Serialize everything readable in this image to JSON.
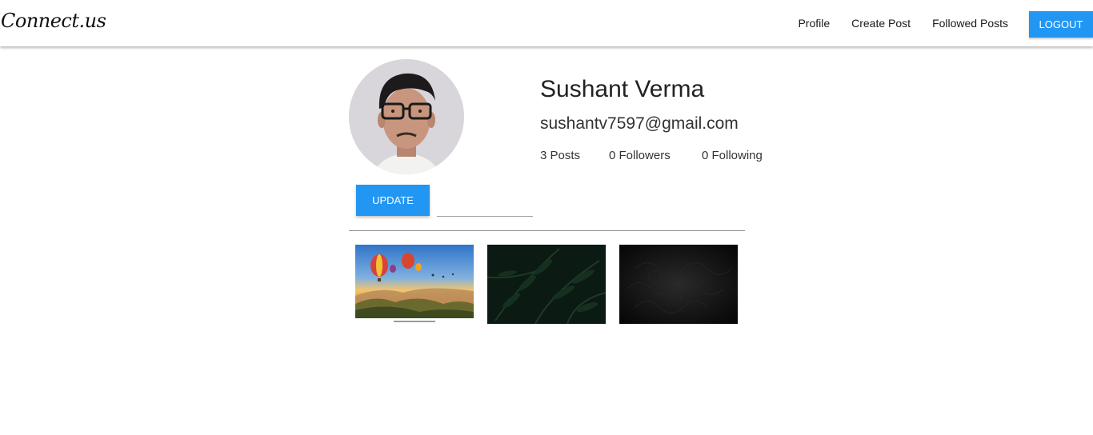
{
  "app": {
    "brand": "Connect.us"
  },
  "nav": {
    "links": [
      {
        "label": "Profile"
      },
      {
        "label": "Create Post"
      },
      {
        "label": "Followed Posts"
      }
    ],
    "logout_label": "LOGOUT"
  },
  "profile": {
    "name": "Sushant Verma",
    "email": "sushantv7597@gmail.com",
    "stats": {
      "posts": "3 Posts",
      "followers": "0 Followers",
      "following": "0 Following"
    },
    "update_label": "UPDATE",
    "file_path_value": ""
  },
  "posts": [
    {
      "icon": "hot-air-balloon-landscape-image"
    },
    {
      "icon": "dark-fern-leaves-image"
    },
    {
      "icon": "dark-texture-image"
    }
  ],
  "colors": {
    "accent": "#2196f3",
    "navbar_bg": "#ffffff",
    "divider": "#8f8f8f"
  }
}
